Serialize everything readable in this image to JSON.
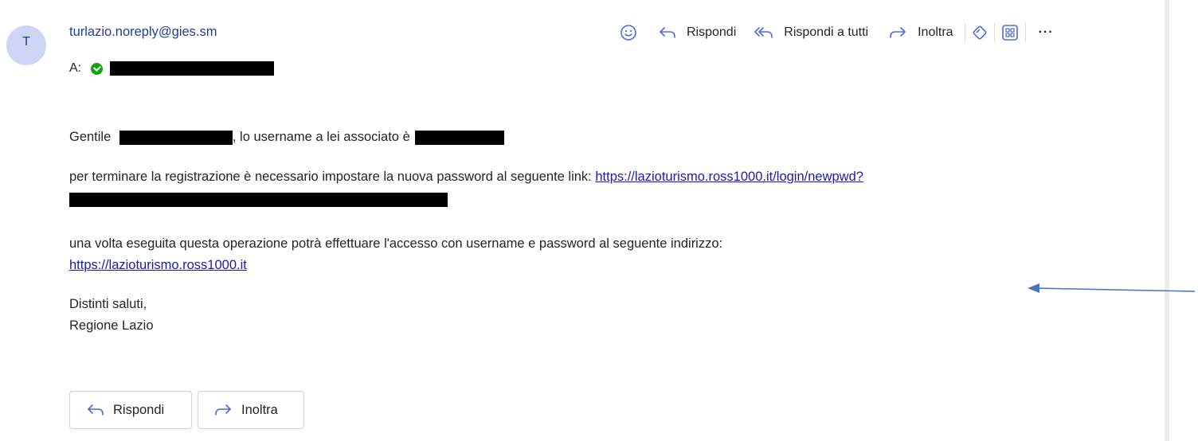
{
  "email": {
    "avatar_initial": "T",
    "sender": "turlazio.noreply@gies.sm",
    "to_label": "A:"
  },
  "toolbar": {
    "emoji_icon": "smiley-icon",
    "reply_label": "Rispondi",
    "reply_all_label": "Rispondi a tutti",
    "forward_label": "Inoltra",
    "more_label": "···"
  },
  "body": {
    "greeting_prefix": "Gentile",
    "greeting_mid": ", lo username a lei associato è",
    "line2_text": "per terminare la registrazione è necessario impostare la nuova password al seguente link:",
    "line2_link": "https://lazioturismo.ross1000.it/login/newpwd?",
    "line3_text": "una volta eseguita questa operazione potrà effettuare l'accesso con username e password al seguente indirizzo:",
    "line3_link": "https://lazioturismo.ross1000.it",
    "signoff": "Distinti saluti,",
    "signature": "Regione Lazio"
  },
  "footer": {
    "reply_label": "Rispondi",
    "forward_label": "Inoltra"
  },
  "colors": {
    "accent": "#4f6bd6",
    "sender": "#1f3d99",
    "link": "#1a1ab8",
    "annotation_arrow": "#4472c4"
  }
}
